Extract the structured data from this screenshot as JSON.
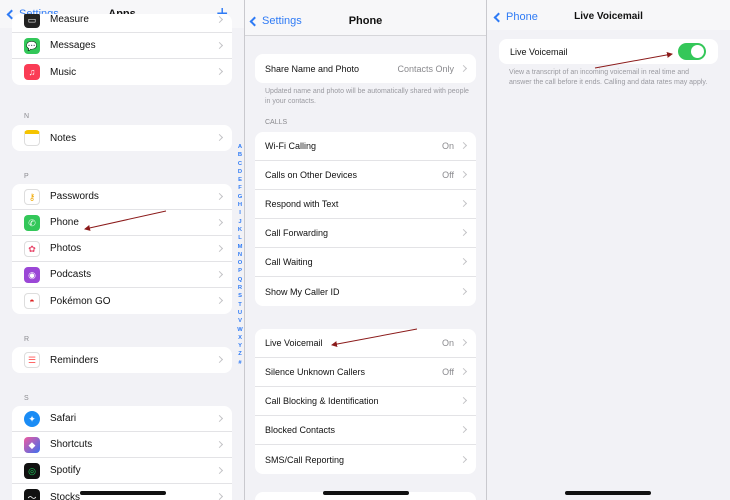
{
  "apps": {
    "back_label": "Settings",
    "title": "Apps",
    "plus": "+",
    "group1": [
      "Measure",
      "Messages",
      "Music"
    ],
    "sec_n": "N",
    "group2": [
      "Notes"
    ],
    "sec_p": "P",
    "group3": [
      "Passwords",
      "Phone",
      "Photos",
      "Podcasts",
      "Pokémon GO"
    ],
    "sec_r": "R",
    "group4": [
      "Reminders"
    ],
    "sec_s": "S",
    "group5": [
      "Safari",
      "Shortcuts",
      "Spotify",
      "Stocks"
    ],
    "index": [
      "A",
      "B",
      "C",
      "D",
      "E",
      "F",
      "G",
      "H",
      "I",
      "J",
      "K",
      "L",
      "M",
      "N",
      "O",
      "P",
      "Q",
      "R",
      "S",
      "T",
      "U",
      "V",
      "W",
      "X",
      "Y",
      "Z",
      "#"
    ]
  },
  "phone": {
    "back_label": "Settings",
    "title": "Phone",
    "share_label": "Share Name and Photo",
    "share_value": "Contacts Only",
    "share_note": "Updated name and photo will be automatically shared with people in your contacts.",
    "calls_header": "CALLS",
    "calls": [
      {
        "label": "Wi-Fi Calling",
        "value": "On"
      },
      {
        "label": "Calls on Other Devices",
        "value": "Off"
      },
      {
        "label": "Respond with Text",
        "value": ""
      },
      {
        "label": "Call Forwarding",
        "value": ""
      },
      {
        "label": "Call Waiting",
        "value": ""
      },
      {
        "label": "Show My Caller ID",
        "value": ""
      }
    ],
    "more": [
      {
        "label": "Live Voicemail",
        "value": "On"
      },
      {
        "label": "Silence Unknown Callers",
        "value": "Off"
      },
      {
        "label": "Call Blocking & Identification",
        "value": ""
      },
      {
        "label": "Blocked Contacts",
        "value": ""
      },
      {
        "label": "SMS/Call Reporting",
        "value": ""
      }
    ]
  },
  "voicemail": {
    "back_label": "Phone",
    "title": "Live Voicemail",
    "toggle_label": "Live Voicemail",
    "toggle_on": true,
    "note": "View a transcript of an incoming voicemail in real time and answer the call before it ends. Calling and data rates may apply."
  },
  "colors": {
    "accent": "#2f7bf5",
    "toggle_on": "#34c759",
    "annotation_arrow": "#8b1a1a"
  }
}
